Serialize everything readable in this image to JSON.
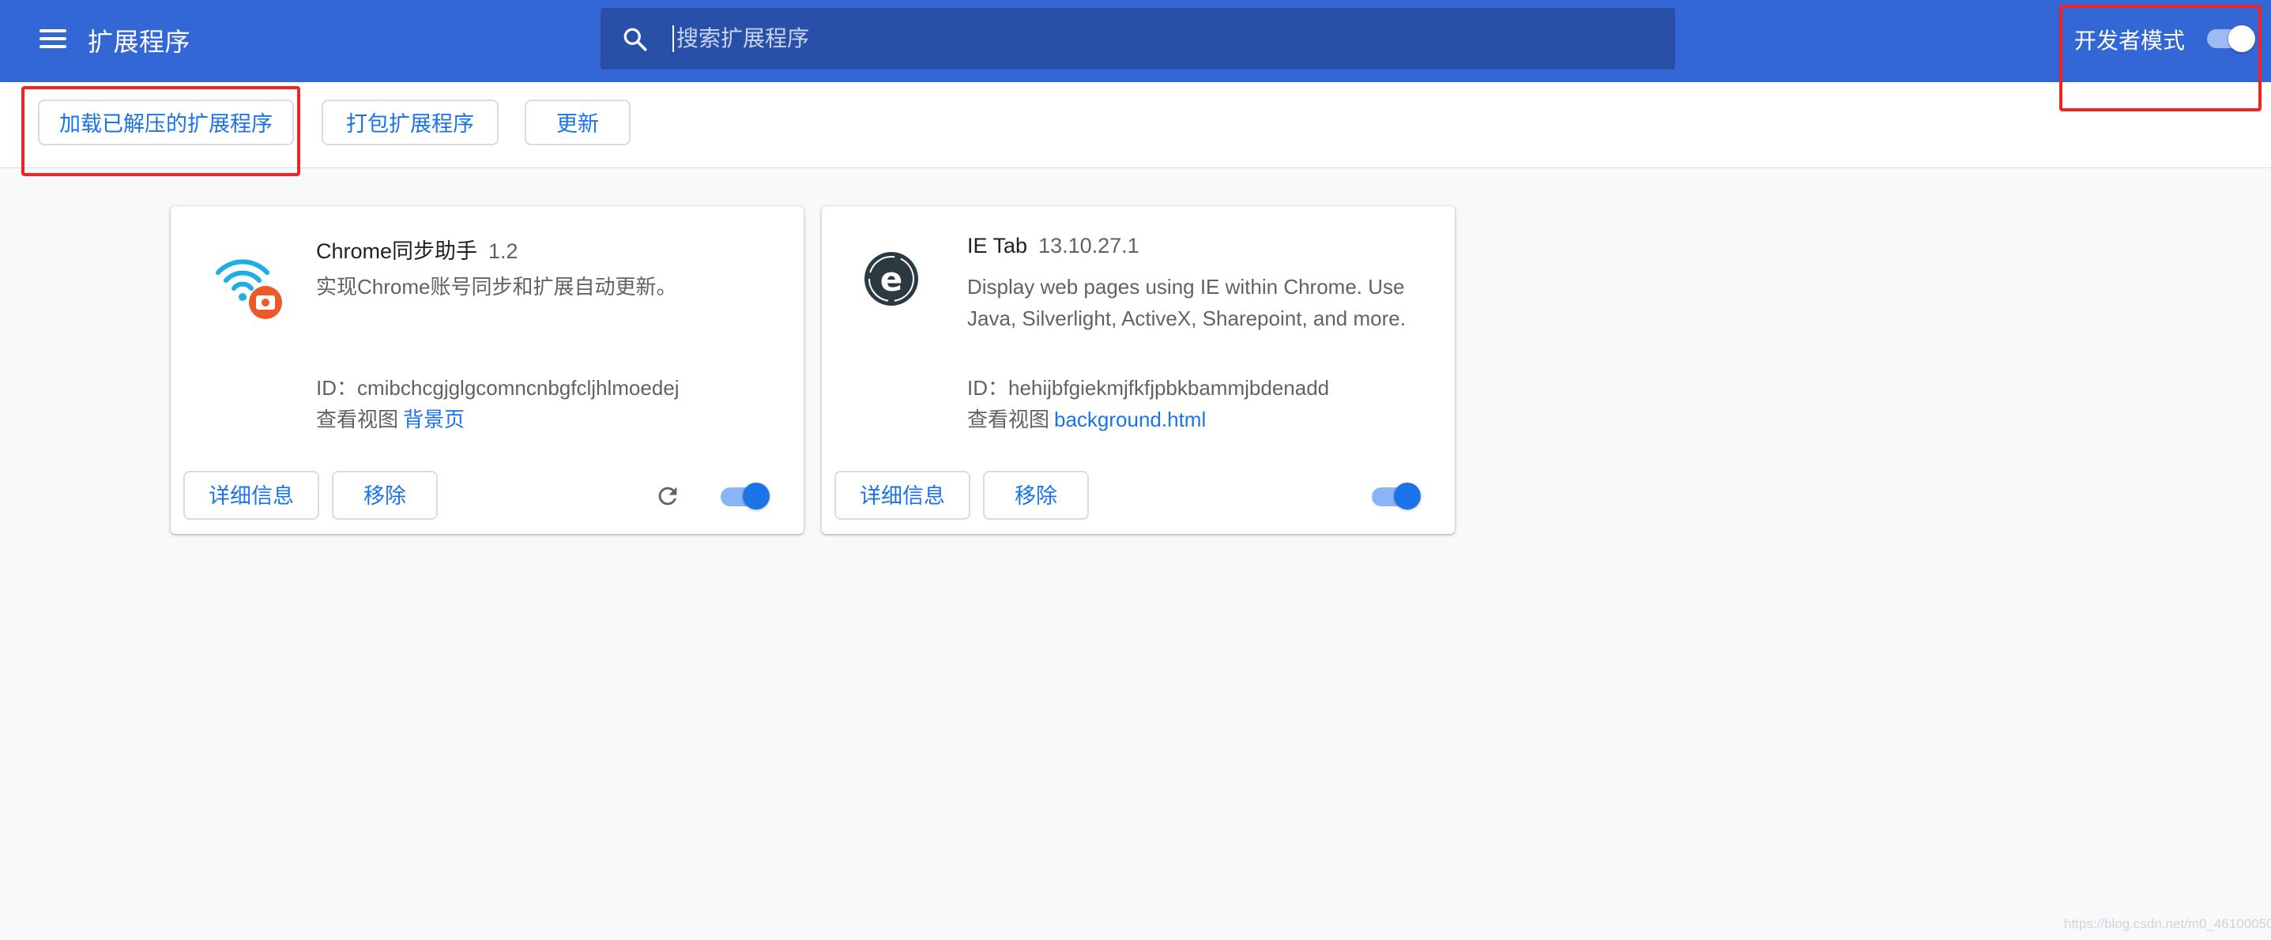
{
  "header": {
    "title": "扩展程序",
    "search_placeholder": "搜索扩展程序",
    "dev_mode_label": "开发者模式",
    "dev_mode_on": true,
    "bg_color": "#3367d6"
  },
  "toolbar": {
    "load_unpacked_label": "加载已解压的扩展程序",
    "pack_label": "打包扩展程序",
    "update_label": "更新"
  },
  "extensions": [
    {
      "name": "Chrome同步助手",
      "version": "1.2",
      "description": "实现Chrome账号同步和扩展自动更新。",
      "id_label": "ID：cmibchcgjglgcomncnbgfcljhlmoedej",
      "views_label": "查看视图",
      "view_link": "背景页",
      "details_label": "详细信息",
      "remove_label": "移除",
      "enabled": true,
      "icon": "wifi-sync-icon"
    },
    {
      "name": "IE Tab",
      "version": "13.10.27.1",
      "description": "Display web pages using IE within Chrome. Use Java, Silverlight, ActiveX, Sharepoint, and more.",
      "id_label": "ID：hehijbfgiekmjfkfjpbkbammjbdenadd",
      "views_label": "查看视图",
      "view_link": "background.html",
      "details_label": "详细信息",
      "remove_label": "移除",
      "enabled": true,
      "icon": "ie-tab-icon"
    }
  ],
  "watermark": "https://blog.csdn.net/m0_46100050",
  "highlight_color": "#f22423"
}
